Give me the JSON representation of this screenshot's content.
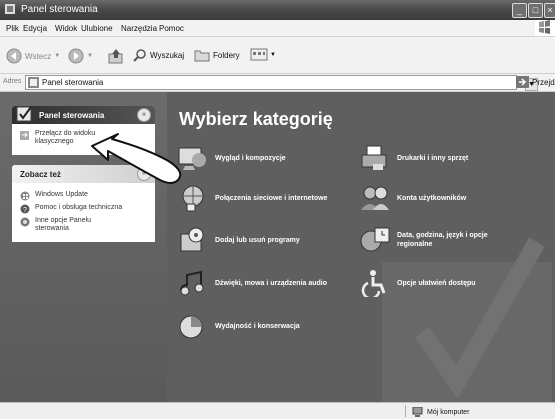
{
  "window": {
    "title": "Panel sterowania"
  },
  "menu": [
    "Plik",
    "Edycja",
    "Widok",
    "Ulubione",
    "Narzędzia",
    "Pomoc"
  ],
  "toolbar": {
    "back": "Wstecz",
    "search": "Wyszukaj",
    "folders": "Foldery"
  },
  "address": {
    "label": "Adres",
    "value": "Panel sterowania",
    "go": "Przejdź"
  },
  "sidebar": {
    "panel_title": "Panel sterowania",
    "switch_view": "Przełącz do widoku klasycznego",
    "see_also_title": "Zobacz też",
    "see_also": [
      "Windows Update",
      "Pomoc i obsługa techniczna",
      "Inne opcje Panelu sterowania"
    ]
  },
  "main": {
    "heading": "Wybierz kategorię",
    "categories": [
      "Wygląd i kompozycje",
      "Drukarki i inny sprzęt",
      "Połączenia sieciowe i internetowe",
      "Konta użytkowników",
      "Dodaj lub usuń programy",
      "Data, godzina, język i opcje regionalne",
      "Dźwięki, mowa i urządzenia audio",
      "Opcje ułatwień dostępu",
      "Wydajność i konserwacja"
    ]
  },
  "status": {
    "text": "Mój komputer"
  }
}
